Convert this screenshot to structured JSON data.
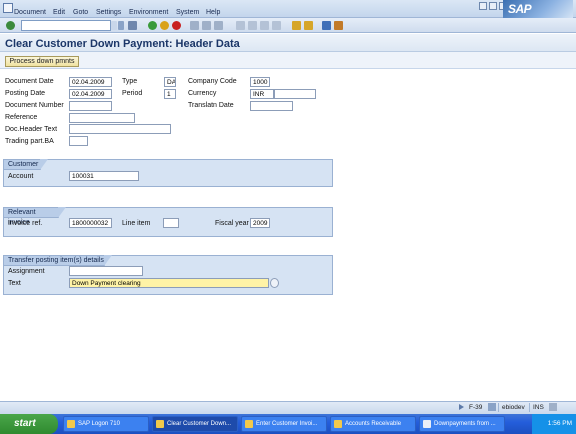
{
  "menu": {
    "items": [
      "Document",
      "Edit",
      "Goto",
      "Settings",
      "Environment",
      "System",
      "Help"
    ]
  },
  "logo": "SAP",
  "title": "Clear Customer Down Payment: Header Data",
  "app_toolbar": {
    "process_button": "Process down pmnts"
  },
  "header": {
    "document_date": {
      "label": "Document Date",
      "value": "02.04.2009"
    },
    "type": {
      "label": "Type",
      "value": "DA"
    },
    "company_code": {
      "label": "Company Code",
      "value": "1000"
    },
    "posting_date": {
      "label": "Posting Date",
      "value": "02.04.2009"
    },
    "period": {
      "label": "Period",
      "value": "1"
    },
    "currency": {
      "label": "Currency",
      "value": "INR"
    },
    "document_number": {
      "label": "Document Number",
      "value": ""
    },
    "translatn_date": {
      "label": "Translatn Date",
      "value": ""
    },
    "reference": {
      "label": "Reference",
      "value": ""
    },
    "doc_header_text": {
      "label": "Doc.Header Text",
      "value": ""
    },
    "trading_part_ba": {
      "label": "Trading part.BA",
      "value": ""
    }
  },
  "customer": {
    "title": "Customer",
    "account": {
      "label": "Account",
      "value": "100031"
    }
  },
  "relevant_invoice": {
    "title": "Relevant invoice",
    "invoice_ref": {
      "label": "Invoice ref.",
      "value": "1800000032"
    },
    "line_item": {
      "label": "Line item",
      "value": ""
    },
    "fiscal_year": {
      "label": "Fiscal year",
      "value": "2009"
    }
  },
  "transfer": {
    "title": "Transfer posting item(s) details",
    "assignment": {
      "label": "Assignment",
      "value": ""
    },
    "text": {
      "label": "Text",
      "value": "Down Payment clearing"
    }
  },
  "status": {
    "transaction": "F-39",
    "server": "ebiodev",
    "mode": "INS"
  },
  "taskbar": {
    "start": "start",
    "tasks": [
      "SAP Logon 710",
      "Clear Customer Down...",
      "Enter Customer Invoi...",
      "Accounts Receivable",
      "Downpayments from ..."
    ],
    "clock": "1:56 PM"
  },
  "colors": {
    "group_bg": "#d6e3f3",
    "text_field_highlight": "#fff3a6",
    "title_color": "#1b3668"
  }
}
